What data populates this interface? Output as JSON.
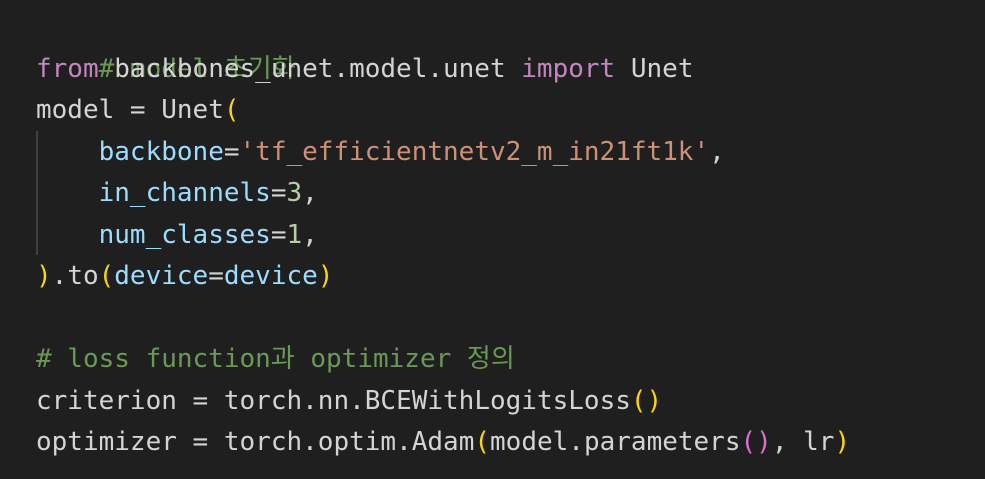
{
  "editor": {
    "theme_colors": {
      "background": "#1f1f1f",
      "comment": "#6a9955",
      "keyword": "#c586c0",
      "variable": "#9cdcfe",
      "string": "#ce9178",
      "number": "#b5cea8",
      "function": "#dcdcaa",
      "class": "#4ec9b0",
      "bracket_gold": "#ffd700",
      "bracket_purple": "#da70d6"
    },
    "lines": [
      {
        "tokens": [
          "# model 초기화"
        ]
      },
      {
        "tokens": [
          "from",
          " ",
          "backbones_unet.model.unet",
          " ",
          "import",
          " ",
          "Unet"
        ]
      },
      {
        "tokens": [
          "model",
          " = ",
          "Unet",
          "("
        ]
      },
      {
        "tokens": [
          "    ",
          "backbone",
          "=",
          "'tf_efficientnetv2_m_in21ft1k'",
          ","
        ]
      },
      {
        "tokens": [
          "    ",
          "in_channels",
          "=",
          "3",
          ","
        ]
      },
      {
        "tokens": [
          "    ",
          "num_classes",
          "=",
          "1",
          ","
        ]
      },
      {
        "tokens": [
          ")",
          ".",
          "to",
          "(",
          "device",
          "=",
          "device",
          ")"
        ]
      },
      {
        "tokens": [
          ""
        ]
      },
      {
        "tokens": [
          "# loss function과 optimizer 정의"
        ]
      },
      {
        "tokens": [
          "criterion",
          " = ",
          "torch",
          ".",
          "nn",
          ".",
          "BCEWithLogitsLoss",
          "(",
          ")"
        ]
      },
      {
        "tokens": [
          "optimizer",
          " = ",
          "torch",
          ".",
          "optim",
          ".",
          "Adam",
          "(",
          "model",
          ".",
          "parameters",
          "(",
          ")",
          ", ",
          "lr",
          ")"
        ]
      }
    ]
  }
}
